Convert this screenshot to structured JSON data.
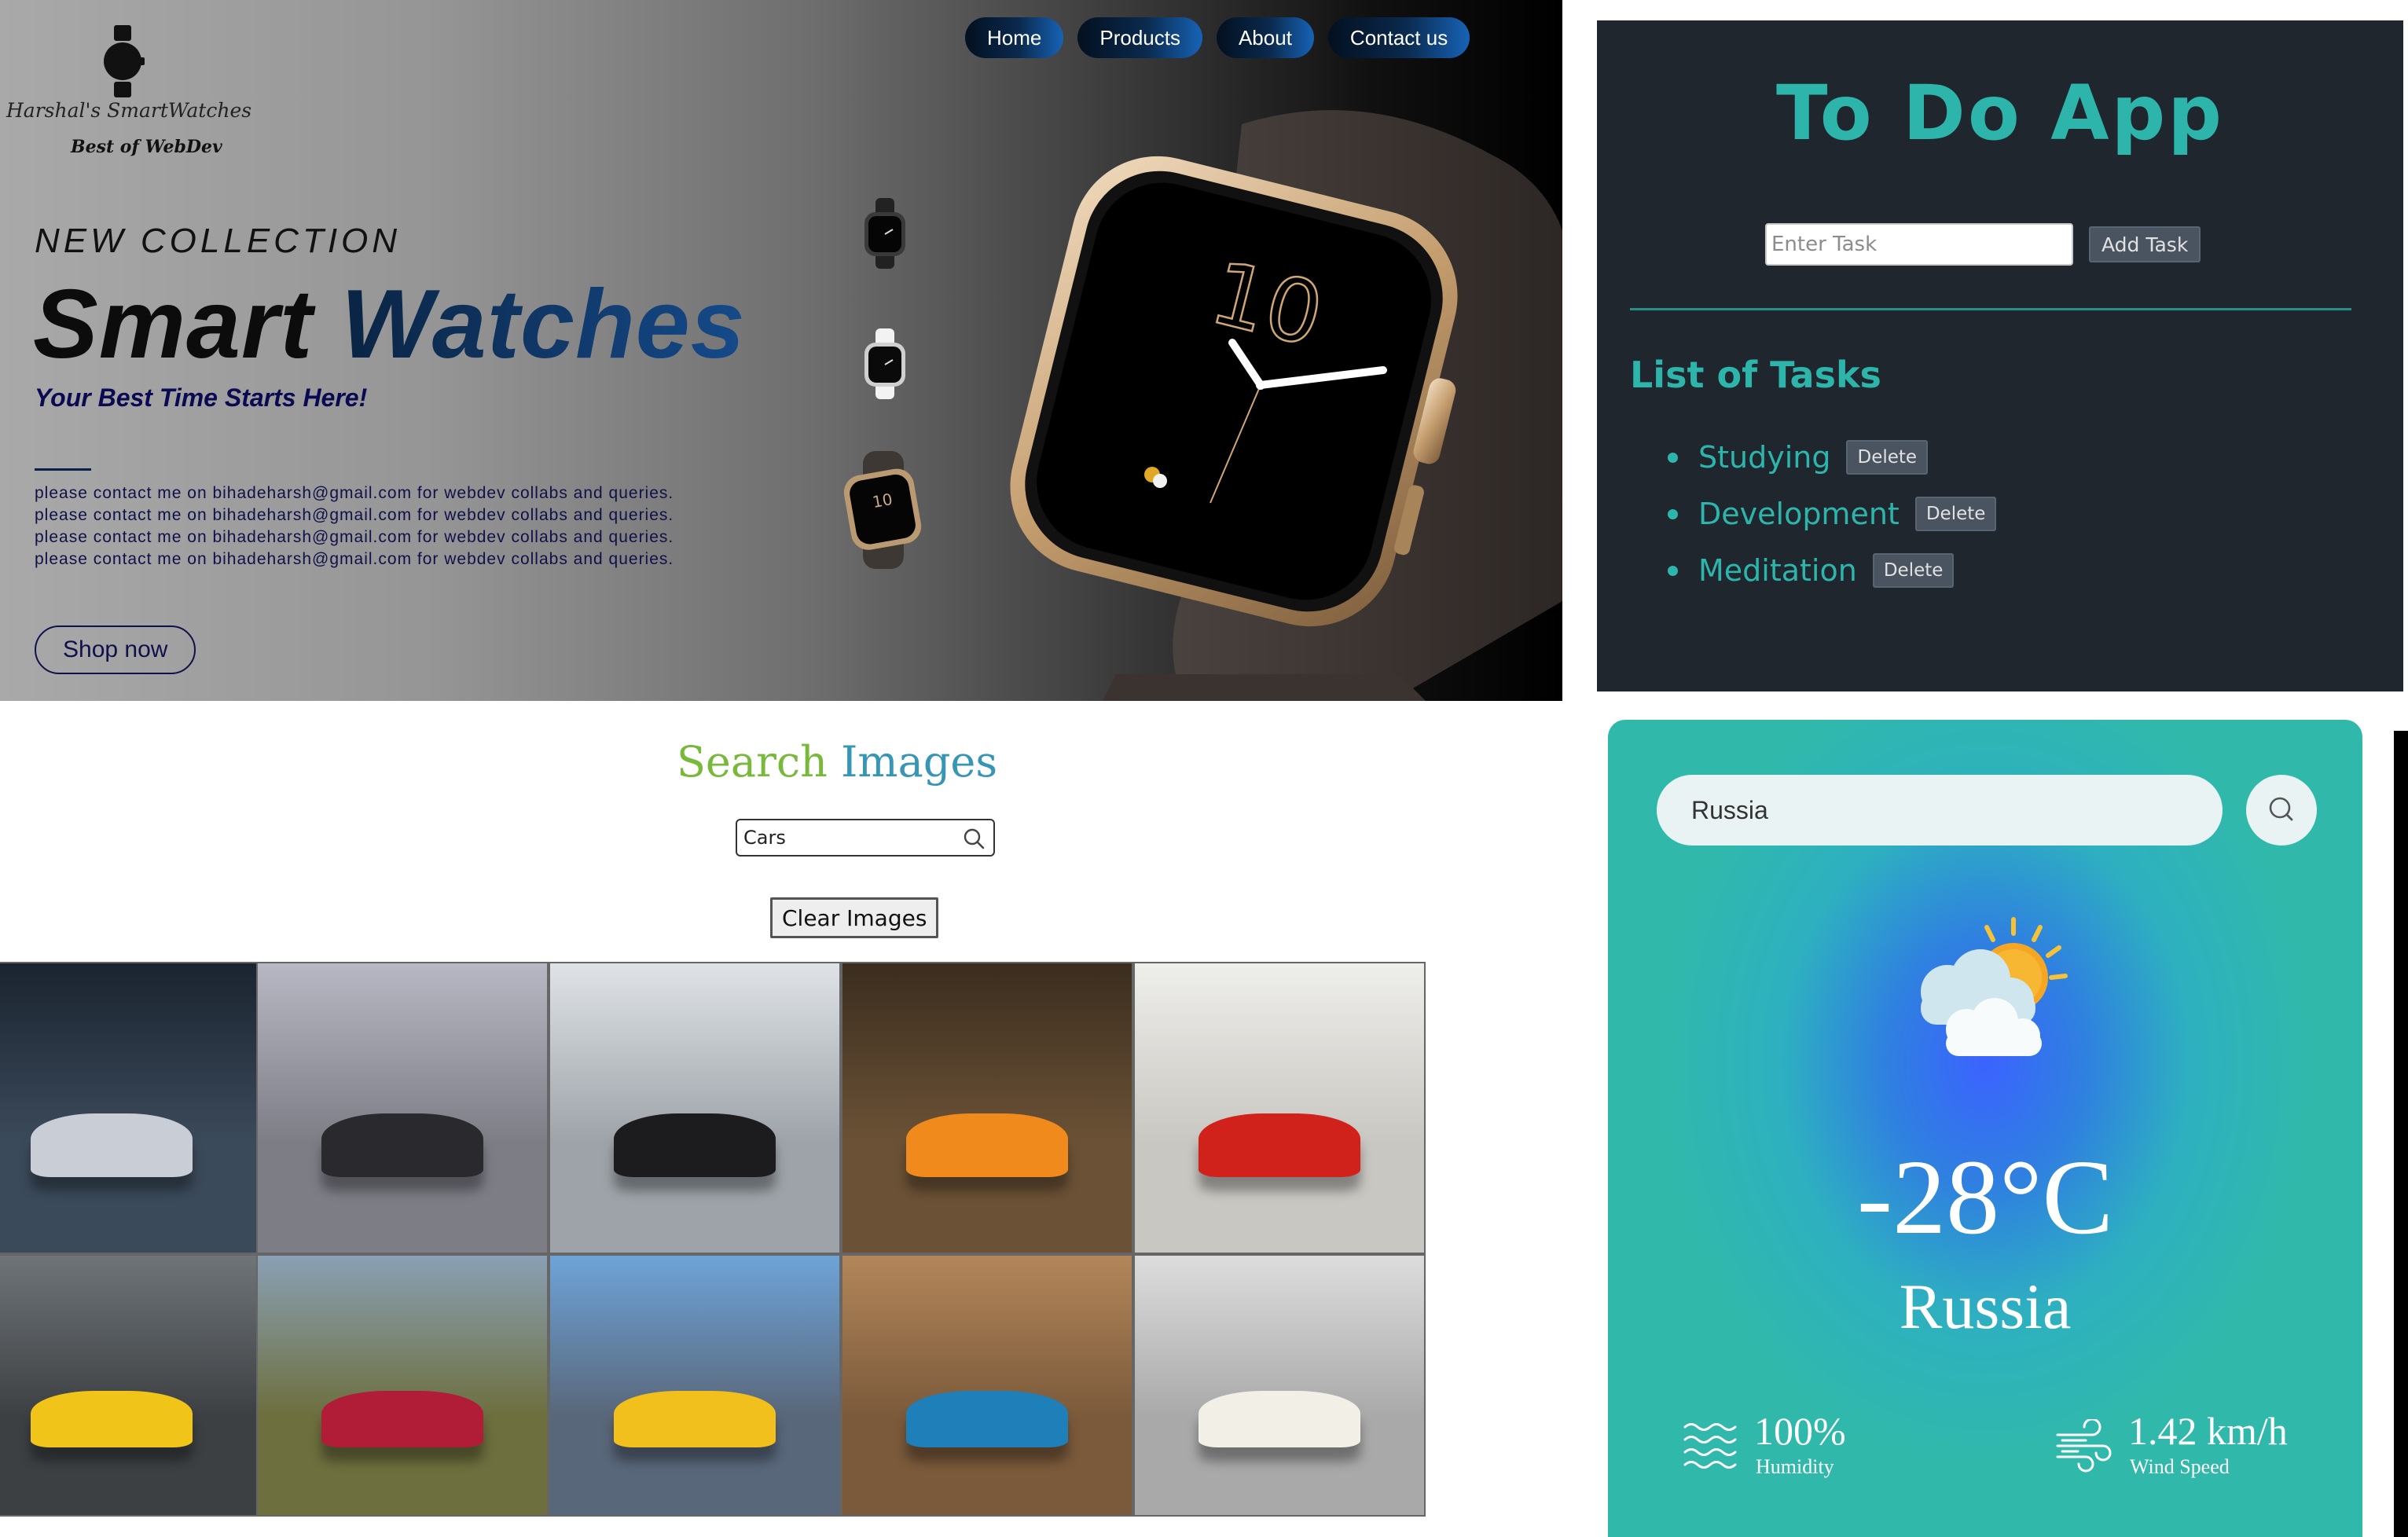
{
  "hero": {
    "brand": "Harshal's SmartWatches",
    "tagline": "Best of WebDev",
    "nav": [
      "Home",
      "Products",
      "About",
      "Contact us"
    ],
    "eyebrow": "NEW COLLECTION",
    "title_part1": "Smart",
    "title_part2": "Watches",
    "subtitle": "Your Best Time Starts Here!",
    "paragraph_lines": [
      "please contact me on bihadeharsh@gmail.com for webdev collabs and queries.",
      "please contact me on bihadeharsh@gmail.com for webdev collabs and queries.",
      "please contact me on bihadeharsh@gmail.com for webdev collabs and queries.",
      "please contact me on bihadeharsh@gmail.com for webdev collabs and queries."
    ],
    "cta": "Shop now",
    "watch_face_hour": "10",
    "accent_color": "#154a8a"
  },
  "todo": {
    "title": "To Do App",
    "input_placeholder": "Enter Task",
    "input_value": "",
    "add_label": "Add Task",
    "list_title": "List of Tasks",
    "tasks": [
      {
        "text": "Studying",
        "delete_label": "Delete"
      },
      {
        "text": "Development",
        "delete_label": "Delete"
      },
      {
        "text": "Meditation",
        "delete_label": "Delete"
      }
    ],
    "accent_color": "#2db5ac"
  },
  "image_search": {
    "title_word1": "Search",
    "title_word2": "Images",
    "query": "Cars",
    "clear_label": "Clear Images",
    "results": [
      "silver-camaro",
      "black-mustang",
      "black-porsche",
      "orange-lamborghini",
      "red-ferrari",
      "grey-amg-yellow-stripe",
      "red-amg-forest",
      "yellow-amg-road",
      "blue-camaro-desert",
      "white-classic-cars-row"
    ]
  },
  "weather": {
    "city_input": "Russia",
    "icon": "partly-cloudy-sun-icon",
    "temperature": "-28°C",
    "city": "Russia",
    "humidity": "100%",
    "humidity_label": "Humidity",
    "wind": "1.42 km/h",
    "wind_label": "Wind Speed"
  }
}
